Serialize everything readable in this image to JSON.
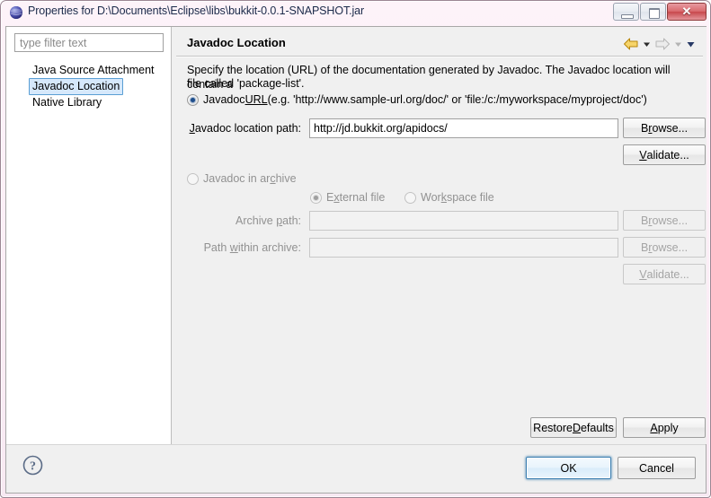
{
  "window": {
    "title": "Properties for D:\\Documents\\Eclipse\\libs\\bukkit-0.0.1-SNAPSHOT.jar",
    "icon": "eclipse-properties-sphere-icon",
    "controls": {
      "minimize": "minimize-icon",
      "maximize": "maximize-icon",
      "close_glyph": "✕"
    }
  },
  "sidebar": {
    "filter": {
      "placeholder": "type filter text",
      "value": ""
    },
    "items": [
      {
        "label": "Java Source Attachment",
        "selected": false
      },
      {
        "label": "Javadoc Location",
        "selected": true
      },
      {
        "label": "Native Library",
        "selected": false
      }
    ]
  },
  "page": {
    "title": "Javadoc Location",
    "nav": {
      "back_icon": "back-arrow-icon",
      "back_menu_icon": "chevron-down-icon",
      "forward_icon": "forward-arrow-icon",
      "forward_menu_icon": "chevron-down-icon",
      "menu_icon": "chevron-down-icon"
    },
    "description_line1": "Specify the location (URL) of the documentation generated by Javadoc. The Javadoc location will contain a",
    "description_line2": "file called 'package-list'.",
    "javadoc_url": {
      "radio_selected": true,
      "label_pre": "Javadoc ",
      "label_mnemonic": "URL",
      "label_post": " (e.g. 'http://www.sample-url.org/doc/' or 'file:/c:/myworkspace/myproject/doc')",
      "path_label_mnemonic": "J",
      "path_label_rest": "avadoc location path:",
      "path_value": "http://jd.bukkit.org/apidocs/",
      "browse_pre": "B",
      "browse_mn": "r",
      "browse_post": "owse...",
      "validate_pre": "",
      "validate_mn": "V",
      "validate_post": "alidate..."
    },
    "javadoc_archive": {
      "radio_selected": false,
      "enabled": false,
      "label_pre": "Javadoc in ar",
      "label_mnemonic": "c",
      "label_post": "hive",
      "external_file": {
        "pre": "E",
        "mn": "x",
        "post": "ternal file",
        "selected": true
      },
      "workspace_file": {
        "pre": "Wor",
        "mn": "k",
        "post": "space file",
        "selected": false
      },
      "archive_path_label_pre": "Archive ",
      "archive_path_label_mn": "p",
      "archive_path_label_post": "ath:",
      "archive_path_value": "",
      "path_within_label_pre": "Path ",
      "path_within_label_mn": "w",
      "path_within_label_post": "ithin archive:",
      "path_within_value": "",
      "browse1_pre": "B",
      "browse1_mn": "r",
      "browse1_post": "owse...",
      "browse2_pre": "B",
      "browse2_mn": "r",
      "browse2_post": "owse...",
      "validate_pre": "",
      "validate_mn": "V",
      "validate_post": "alidate..."
    },
    "restore_defaults": {
      "pre": "Restore ",
      "mn": "D",
      "post": "efaults"
    },
    "apply": {
      "pre": "",
      "mn": "A",
      "post": "pply"
    }
  },
  "footer": {
    "help_icon": "help-question-icon",
    "ok_label": "OK",
    "cancel_label": "Cancel"
  },
  "colors": {
    "title_bar": "#fbeef6",
    "selection_blue": "#d6e8fb",
    "selection_border": "#5a9fd4",
    "radio_dot": "#1f4e8c",
    "close_button_red": "#c7474c",
    "nav_back_gold": "#e8b733",
    "panel_bg": "#f0f0f0"
  }
}
